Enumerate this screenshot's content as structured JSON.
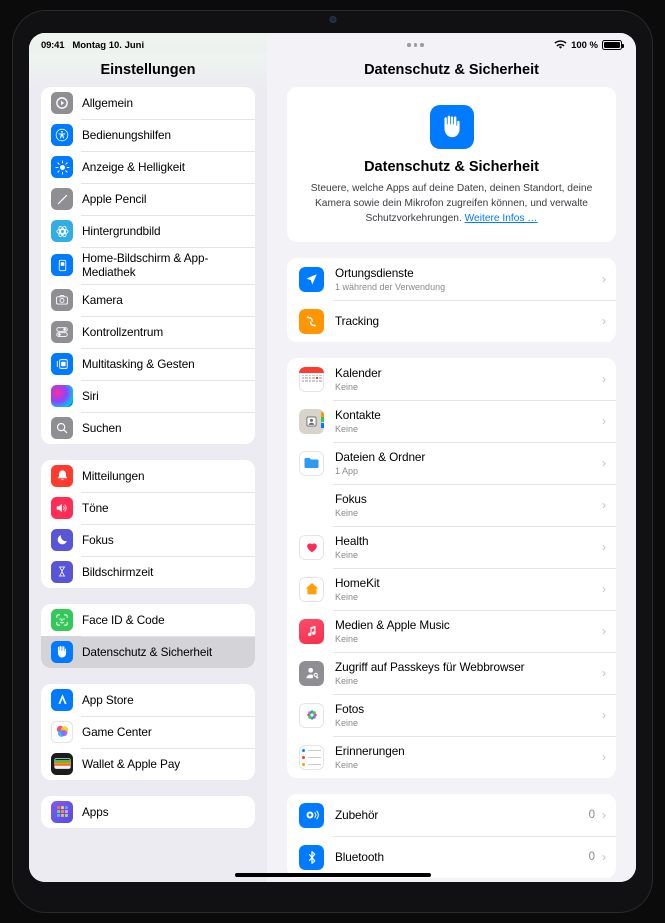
{
  "status": {
    "time": "09:41",
    "date": "Montag 10. Juni",
    "battery_percent": "100 %",
    "wifi_icon": "wifi-icon",
    "battery_icon": "battery-full-icon"
  },
  "sidebar": {
    "title": "Einstellungen",
    "groups": [
      {
        "items": [
          {
            "label": "Allgemein",
            "icon": "gear-icon",
            "color": "ic-gray"
          },
          {
            "label": "Bedienungshilfen",
            "icon": "accessibility-icon",
            "color": "ic-blue"
          },
          {
            "label": "Anzeige & Helligkeit",
            "icon": "brightness-icon",
            "color": "ic-blue"
          },
          {
            "label": "Apple Pencil",
            "icon": "pencil-icon",
            "color": "ic-gray"
          },
          {
            "label": "Hintergrundbild",
            "icon": "wallpaper-icon",
            "color": "ic-cyan"
          },
          {
            "label": "Home-Bildschirm & App-Mediathek",
            "icon": "home-screen-icon",
            "color": "ic-blue"
          },
          {
            "label": "Kamera",
            "icon": "camera-icon",
            "color": "ic-gray"
          },
          {
            "label": "Kontrollzentrum",
            "icon": "control-center-icon",
            "color": "ic-gray"
          },
          {
            "label": "Multitasking & Gesten",
            "icon": "multitasking-icon",
            "color": "ic-blue"
          },
          {
            "label": "Siri",
            "icon": "siri-icon",
            "color": "ic-siri"
          },
          {
            "label": "Suchen",
            "icon": "search-icon",
            "color": "ic-gray"
          }
        ]
      },
      {
        "items": [
          {
            "label": "Mitteilungen",
            "icon": "bell-icon",
            "color": "ic-red"
          },
          {
            "label": "Töne",
            "icon": "speaker-icon",
            "color": "ic-pink"
          },
          {
            "label": "Fokus",
            "icon": "moon-icon",
            "color": "ic-indigo"
          },
          {
            "label": "Bildschirmzeit",
            "icon": "hourglass-icon",
            "color": "ic-indigo"
          }
        ]
      },
      {
        "items": [
          {
            "label": "Face ID & Code",
            "icon": "face-id-icon",
            "color": "ic-green"
          },
          {
            "label": "Datenschutz & Sicherheit",
            "icon": "hand-raised-icon",
            "color": "ic-blue",
            "selected": true
          }
        ]
      },
      {
        "items": [
          {
            "label": "App Store",
            "icon": "app-store-icon",
            "color": "ic-blue"
          },
          {
            "label": "Game Center",
            "icon": "game-center-icon",
            "color": "ic-gamec"
          },
          {
            "label": "Wallet & Apple Pay",
            "icon": "wallet-icon",
            "color": "ic-wallet"
          }
        ]
      },
      {
        "items": [
          {
            "label": "Apps",
            "icon": "apps-grid-icon",
            "color": "ic-apps"
          }
        ]
      }
    ]
  },
  "detail": {
    "title": "Datenschutz & Sicherheit",
    "multitasking_dots": "multitasking-dots-icon",
    "hero": {
      "icon": "hand-raised-icon",
      "title": "Datenschutz & Sicherheit",
      "description": "Steuere, welche Apps auf deine Daten, deinen Standort, deine Kamera sowie dein Mikrofon zugreifen können, und verwalte Schutzvorkehrungen.",
      "link": "Weitere Infos …"
    },
    "groups": [
      {
        "rows": [
          {
            "title": "Ortungsdienste",
            "subtitle": "1 während der Verwendung",
            "icon": "location-arrow-icon",
            "chevron": "›"
          },
          {
            "title": "Tracking",
            "subtitle": "",
            "icon": "tracking-hand-icon",
            "chevron": "›"
          }
        ]
      },
      {
        "rows": [
          {
            "title": "Kalender",
            "subtitle": "Keine",
            "icon": "calendar-icon",
            "chevron": "›"
          },
          {
            "title": "Kontakte",
            "subtitle": "Keine",
            "icon": "contacts-icon",
            "chevron": "›"
          },
          {
            "title": "Dateien & Ordner",
            "subtitle": "1 App",
            "icon": "files-folder-icon",
            "chevron": "›"
          },
          {
            "title": "Fokus",
            "subtitle": "Keine",
            "icon": "moon-icon",
            "chevron": "›"
          },
          {
            "title": "Health",
            "subtitle": "Keine",
            "icon": "heart-icon",
            "chevron": "›"
          },
          {
            "title": "HomeKit",
            "subtitle": "Keine",
            "icon": "house-icon",
            "chevron": "›"
          },
          {
            "title": "Medien & Apple Music",
            "subtitle": "Keine",
            "icon": "music-note-icon",
            "chevron": "›"
          },
          {
            "title": "Zugriff auf Passkeys für Webbrowser",
            "subtitle": "Keine",
            "icon": "passkey-person-icon",
            "chevron": "›"
          },
          {
            "title": "Fotos",
            "subtitle": "Keine",
            "icon": "photos-icon",
            "chevron": "›"
          },
          {
            "title": "Erinnerungen",
            "subtitle": "Keine",
            "icon": "reminders-icon",
            "chevron": "›"
          }
        ]
      },
      {
        "rows": [
          {
            "title": "Zubehör",
            "subtitle": "",
            "value": "0",
            "icon": "accessory-icon",
            "chevron": "›"
          },
          {
            "title": "Bluetooth",
            "subtitle": "",
            "value": "0",
            "icon": "bluetooth-icon",
            "chevron": "›"
          }
        ]
      }
    ]
  },
  "colors": {
    "accent": "#007aff",
    "sidebar_bg": "#ecebf1",
    "detail_bg": "#f2f2f7",
    "selected_row": "#d3d3d8"
  }
}
